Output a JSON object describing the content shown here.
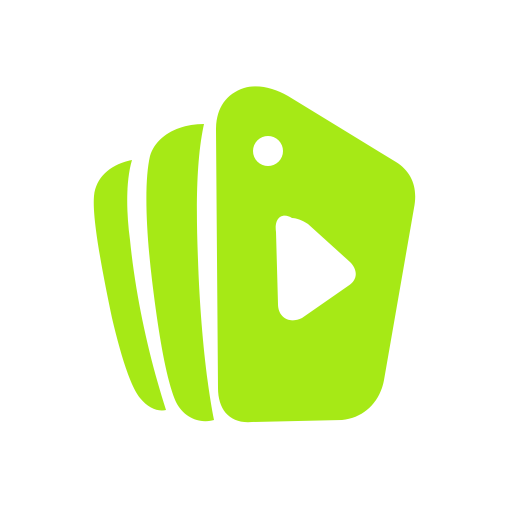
{
  "logo": {
    "icon": "video-price-tag-stack-icon",
    "colors": {
      "brand": "#A6E916",
      "background": "#FFFFFF"
    }
  }
}
